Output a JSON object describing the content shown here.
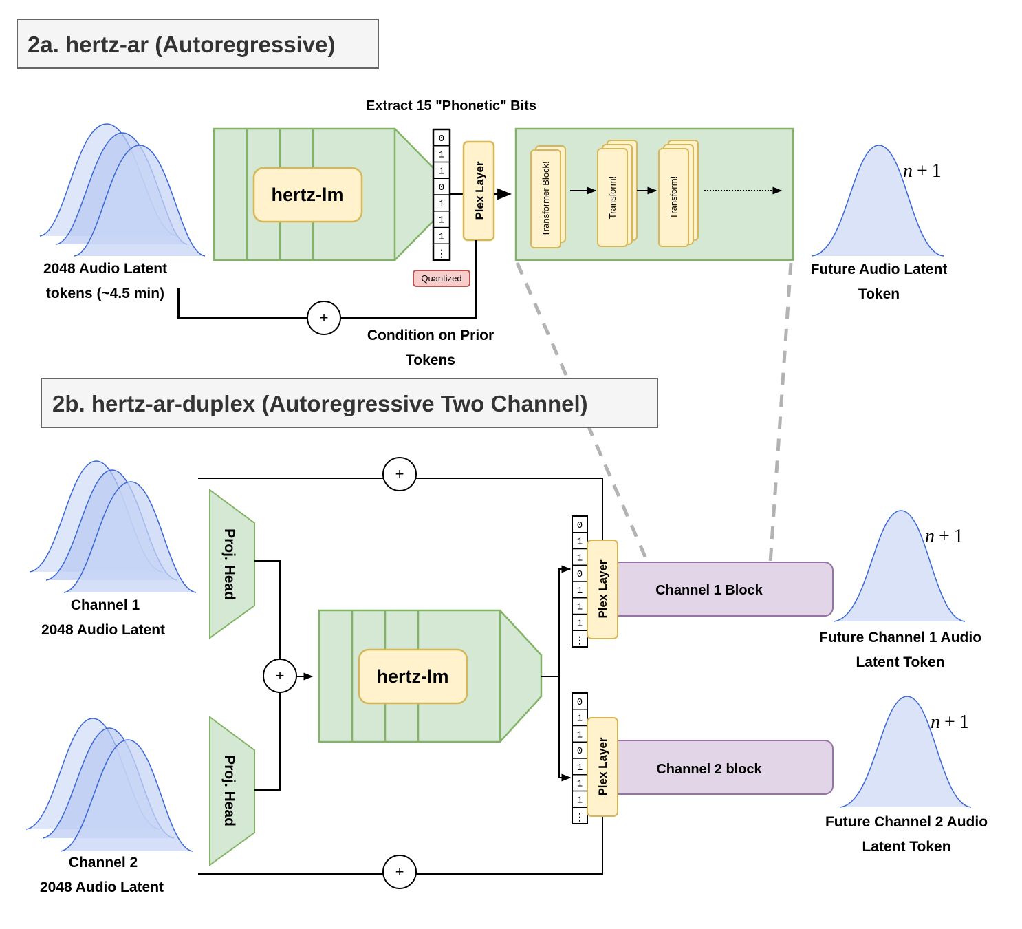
{
  "section_a": {
    "title": "2a. hertz-ar (Autoregressive)",
    "input_label_line1": "2048 Audio Latent",
    "input_label_line2": "tokens (~4.5 min)",
    "hertz_lm": "hertz-lm",
    "extract_label": "Extract 15 \"Phonetic\" Bits",
    "bits": [
      "0",
      "1",
      "1",
      "0",
      "1",
      "1",
      "1",
      "⋮"
    ],
    "plex_layer": "Plex Layer",
    "quantized_badge": "Quantized",
    "transformer_blocks": [
      "Transformer Block!",
      "Transform!",
      "Transform!"
    ],
    "plus_symbol": "+",
    "condition_label_line1": "Condition on Prior",
    "condition_label_line2": "Tokens",
    "output_label_line1": "Future Audio Latent",
    "output_label_line2": "Token",
    "n_plus_1": {
      "n": "n",
      "plus": "+",
      "one": "1"
    }
  },
  "section_b": {
    "title": "2b. hertz-ar-duplex (Autoregressive Two Channel)",
    "channel1_input_line1": "Channel 1",
    "channel1_input_line2": "2048 Audio Latent",
    "channel2_input_line1": "Channel 2",
    "channel2_input_line2": "2048 Audio Latent",
    "proj_head": "Proj. Head",
    "hertz_lm": "hertz-lm",
    "plus_symbol": "+",
    "bits": [
      "0",
      "1",
      "1",
      "0",
      "1",
      "1",
      "1",
      "⋮"
    ],
    "plex_layer": "Plex Layer",
    "channel1_block": "Channel 1 Block",
    "channel2_block": "Channel 2 block",
    "channel1_output_line1": "Future Channel 1 Audio",
    "channel1_output_line2": "Latent Token",
    "channel2_output_line1": "Future Channel 2 Audio",
    "channel2_output_line2": "Latent Token",
    "n_plus_1": {
      "n": "n",
      "plus": "+",
      "one": "1"
    }
  },
  "colors": {
    "green_fill": "#d5e8d4",
    "green_stroke": "#82b366",
    "yellow_fill": "#fff2cc",
    "yellow_stroke": "#d6b656",
    "purple_fill": "#e1d5e7",
    "purple_stroke": "#9673a6",
    "red_fill": "#f8cecc",
    "red_stroke": "#b85450",
    "dist_fill": "#dae3f8",
    "dist_stroke": "#3a66d6",
    "title_fill": "#f5f5f5",
    "title_stroke": "#666666",
    "dashed": "#b3b3b3"
  }
}
